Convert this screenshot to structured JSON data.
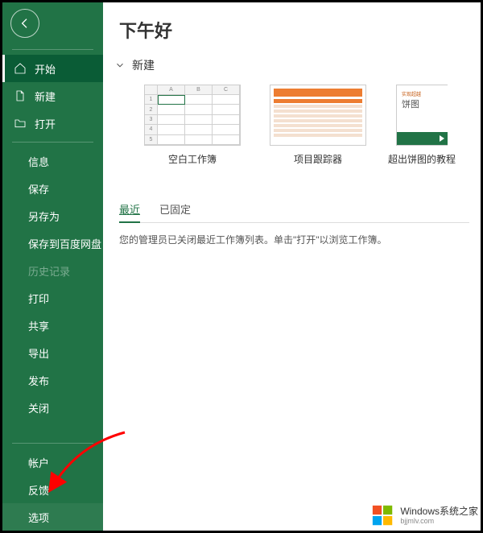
{
  "sidebar": {
    "home": "开始",
    "new": "新建",
    "open": "打开",
    "items": [
      "信息",
      "保存",
      "另存为",
      "保存到百度网盘",
      "历史记录",
      "打印",
      "共享",
      "导出",
      "发布",
      "关闭"
    ],
    "footer": [
      "帐户",
      "反馈",
      "选项"
    ]
  },
  "page": {
    "title": "下午好",
    "new_label": "新建",
    "templates": [
      {
        "label": "空白工作簿"
      },
      {
        "label": "项目跟踪器"
      },
      {
        "label": "超出饼图的教程",
        "t1": "实现超越",
        "t2": "饼图"
      }
    ],
    "tabs": {
      "recent": "最近",
      "pinned": "已固定"
    },
    "message": "您的管理员已关闭最近工作簿列表。单击\"打开\"以浏览工作簿。"
  },
  "watermark": {
    "main": "Windows系统之家",
    "sub": "bjjmlv.com"
  }
}
